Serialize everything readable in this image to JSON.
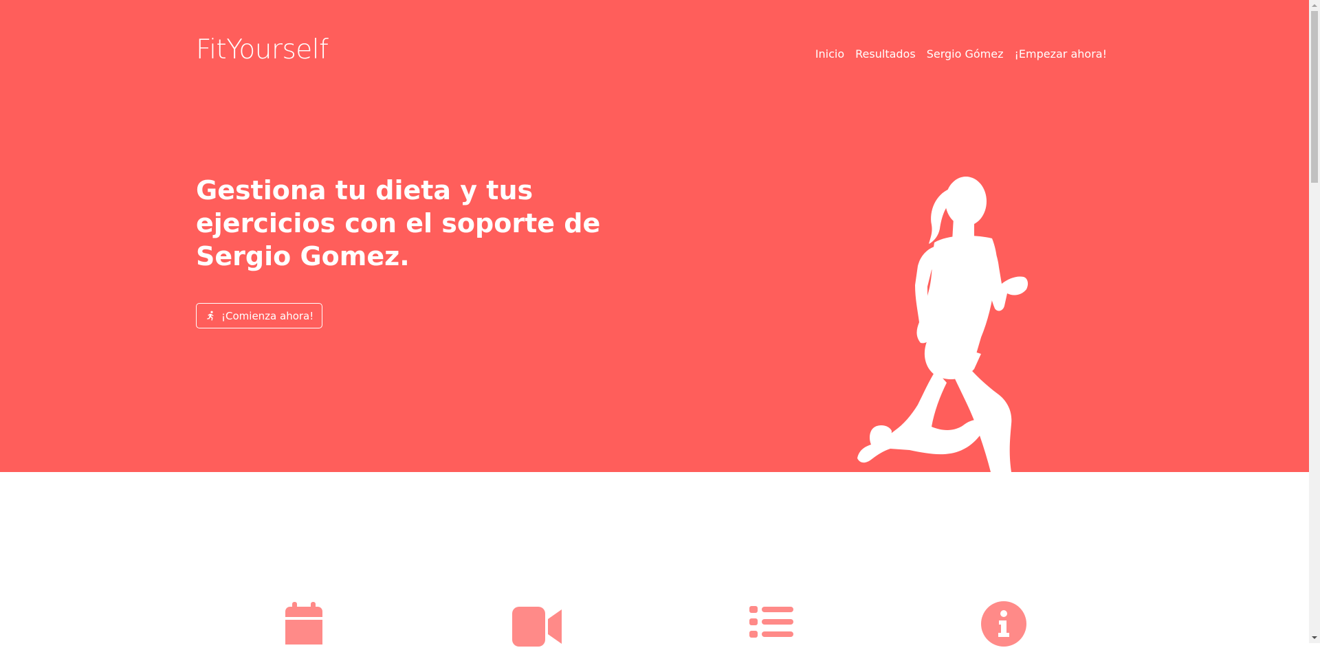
{
  "header": {
    "brand": "FitYourself",
    "nav": [
      {
        "label": "Inicio"
      },
      {
        "label": "Resultados"
      },
      {
        "label": "Sergio Gómez"
      },
      {
        "label": "¡Empezar ahora!"
      }
    ]
  },
  "hero": {
    "headline": "Gestiona tu dieta y tus ejercicios con el soporte de Sergio Gomez.",
    "cta_label": "¡Comienza ahora!",
    "cta_icon": "running-icon",
    "image": "runner-silhouette"
  },
  "features": {
    "icons": [
      "calendar-icon",
      "video-camera-icon",
      "list-icon",
      "info-circle-icon"
    ]
  },
  "colors": {
    "primary": "#ff5e5b",
    "icon": "#ff8a88",
    "text_on_primary": "#ffffff"
  }
}
